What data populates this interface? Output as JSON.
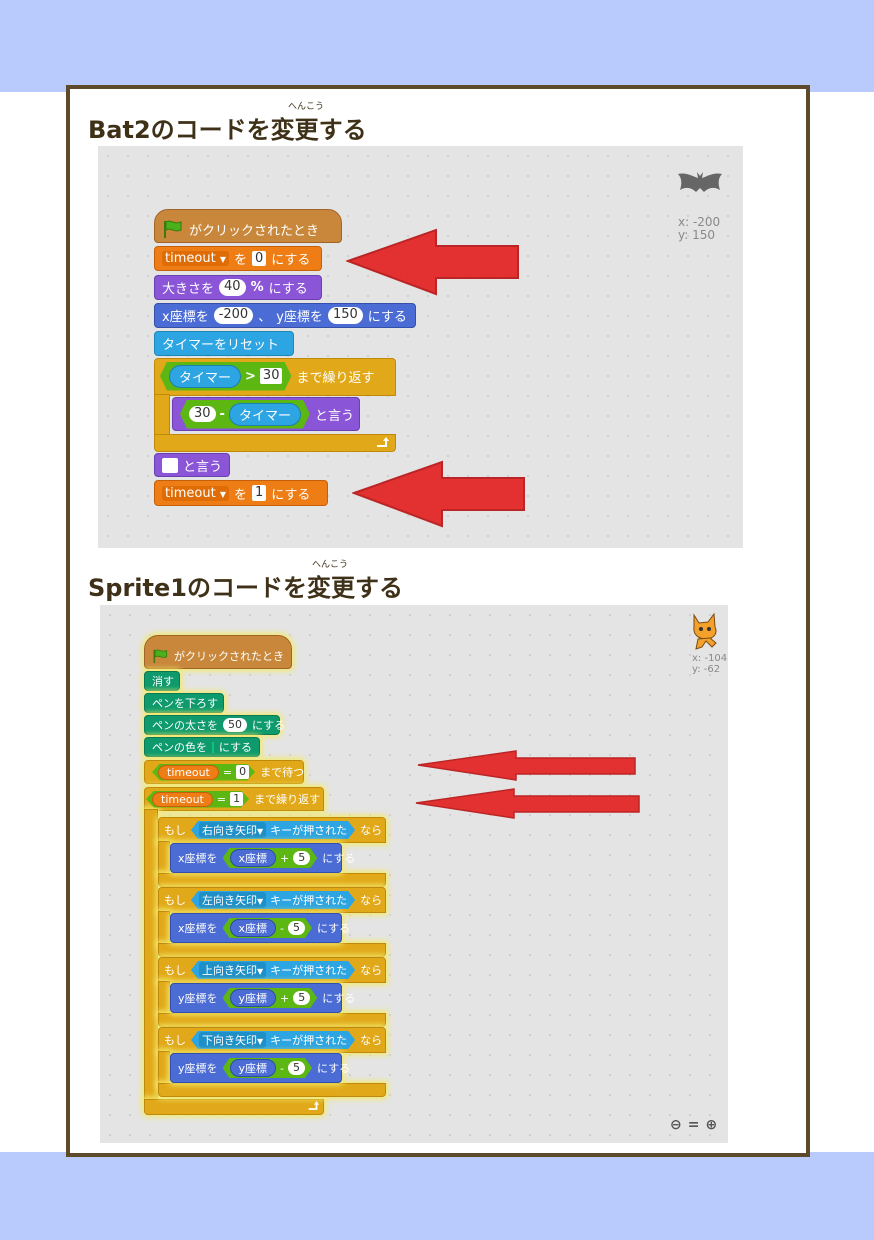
{
  "section1": {
    "title": "Bat2のコードを変更する",
    "ruby": "へんこう",
    "sprite_icon": "bat-icon",
    "coords": {
      "x": "x: -200",
      "y": "y: 150"
    },
    "hat": "がクリックされたとき",
    "set_timeout_0": {
      "var": "timeout",
      "to": "を",
      "value": "0",
      "suffix": "にする"
    },
    "size": {
      "prefix": "大きさを",
      "value": "40",
      "unit": "%",
      "suffix": "にする"
    },
    "goto": {
      "xlabel": "x座標を",
      "x": "-200",
      "sep": "、",
      "ylabel": "y座標を",
      "y": "150",
      "suffix": "にする"
    },
    "reset_timer": "タイマーをリセット",
    "repeat_until": {
      "reporter": "タイマー",
      "op": ">",
      "value": "30",
      "suffix": "まで繰り返す"
    },
    "say_inner": {
      "value": "30",
      "op": "-",
      "reporter": "タイマー",
      "suffix": "と言う"
    },
    "say_empty": "と言う",
    "set_timeout_1": {
      "var": "timeout",
      "to": "を",
      "value": "1",
      "suffix": "にする"
    }
  },
  "section2": {
    "title": "Sprite1のコードを変更する",
    "ruby": "へんこう",
    "sprite_icon": "cat-icon",
    "coords": {
      "x": "x: -104",
      "y": "y: -62"
    },
    "hat": "がクリックされたとき",
    "clear": "消す",
    "pen_down": "ペンを下ろす",
    "pen_size": {
      "prefix": "ペンの太さを",
      "value": "50",
      "suffix": "にする"
    },
    "pen_color": {
      "prefix": "ペンの色を",
      "suffix": "にする"
    },
    "wait_until": {
      "var": "timeout",
      "op": "=",
      "value": "0",
      "suffix": "まで待つ"
    },
    "repeat_until": {
      "var": "timeout",
      "op": "=",
      "value": "1",
      "suffix": "まで繰り返す"
    },
    "if_blocks": [
      {
        "if": "もし",
        "key": "右向き矢印",
        "pressed": "キーが押された",
        "then": "なら",
        "target": "x座標を",
        "reporter": "x座標",
        "op": "+",
        "value": "5",
        "suffix": "にする"
      },
      {
        "if": "もし",
        "key": "左向き矢印",
        "pressed": "キーが押された",
        "then": "なら",
        "target": "x座標を",
        "reporter": "x座標",
        "op": "-",
        "value": "5",
        "suffix": "にする"
      },
      {
        "if": "もし",
        "key": "上向き矢印",
        "pressed": "キーが押された",
        "then": "なら",
        "target": "y座標を",
        "reporter": "y座標",
        "op": "+",
        "value": "5",
        "suffix": "にする"
      },
      {
        "if": "もし",
        "key": "下向き矢印",
        "pressed": "キーが押された",
        "then": "なら",
        "target": "y座標を",
        "reporter": "y座標",
        "op": "-",
        "value": "5",
        "suffix": "にする"
      }
    ],
    "zoom": {
      "out": "zoom-out-icon",
      "reset": "zoom-reset-icon",
      "in": "zoom-in-icon"
    }
  },
  "colors": {
    "band": "#b9cbfc",
    "frame": "#5c4a2a",
    "events": "#c8873b",
    "variables": "#ee7d16",
    "looks": "#8a55d7",
    "motion": "#4a6cd4",
    "sensing": "#2ca5e2",
    "control": "#e1a91a",
    "pen": "#0e9a6c",
    "operators": "#5cb712",
    "arrow": "#e32222"
  }
}
